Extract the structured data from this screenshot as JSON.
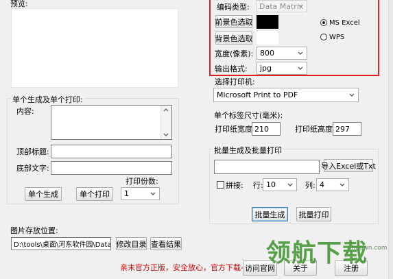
{
  "preview": {
    "label": "预览:"
  },
  "single": {
    "group_title": "单个生成及单个打印:",
    "content_label": "内容:",
    "top_title_label": "顶部标题:",
    "bottom_text_label": "底部文字:",
    "generate_button": "单个生成",
    "print_button": "单个打印",
    "copies_label": "打印份数:",
    "copies_value": "1"
  },
  "settings": {
    "encode_type_label": "编码类型:",
    "encode_type_value": "Data Matrix",
    "fg_color_button": "前景色选取",
    "bg_color_button": "背景色选取",
    "fg_color": "#000000",
    "bg_color": "#ffffff",
    "radio_ms": "MS  Excel",
    "radio_wps": "WPS",
    "radio_selected": "ms",
    "width_label": "宽度(像素):",
    "width_value": "800",
    "format_label": "输出格式:",
    "format_value": "jpg",
    "highlight_color": "#e02020"
  },
  "printer": {
    "label": "选择打印机:",
    "value": "Microsoft Print to PDF",
    "size_label": "单个标签尺寸(毫米):",
    "width_label": "打印纸宽度:",
    "width_value": "210",
    "height_label": "打印纸高度:",
    "height_value": "297"
  },
  "batch": {
    "group_title": "批量生成及批量打印",
    "import_button": "导入Excel或Txt",
    "splice_label": "拼接:",
    "row_label": "行:",
    "row_value": "10",
    "col_label": "列:",
    "col_value": "4",
    "generate_button": "批量生成",
    "print_button": "批量打印"
  },
  "save": {
    "label": "图片存放位置:",
    "path_value": "D:\\tools\\桌面\\河东软件园\\DataMa",
    "modify_button": "修改目录",
    "view_button": "查看结果"
  },
  "footer": {
    "notice": "亲末官方正版，安全放心，官方下载-->",
    "visit_button": "访问官网",
    "middle_button": "关于",
    "register_button": "注册",
    "notice_color": "#cc0000"
  },
  "watermark": {
    "text": "领航下载",
    "url": "lhdown.com",
    "color": "#4a9a3a"
  }
}
